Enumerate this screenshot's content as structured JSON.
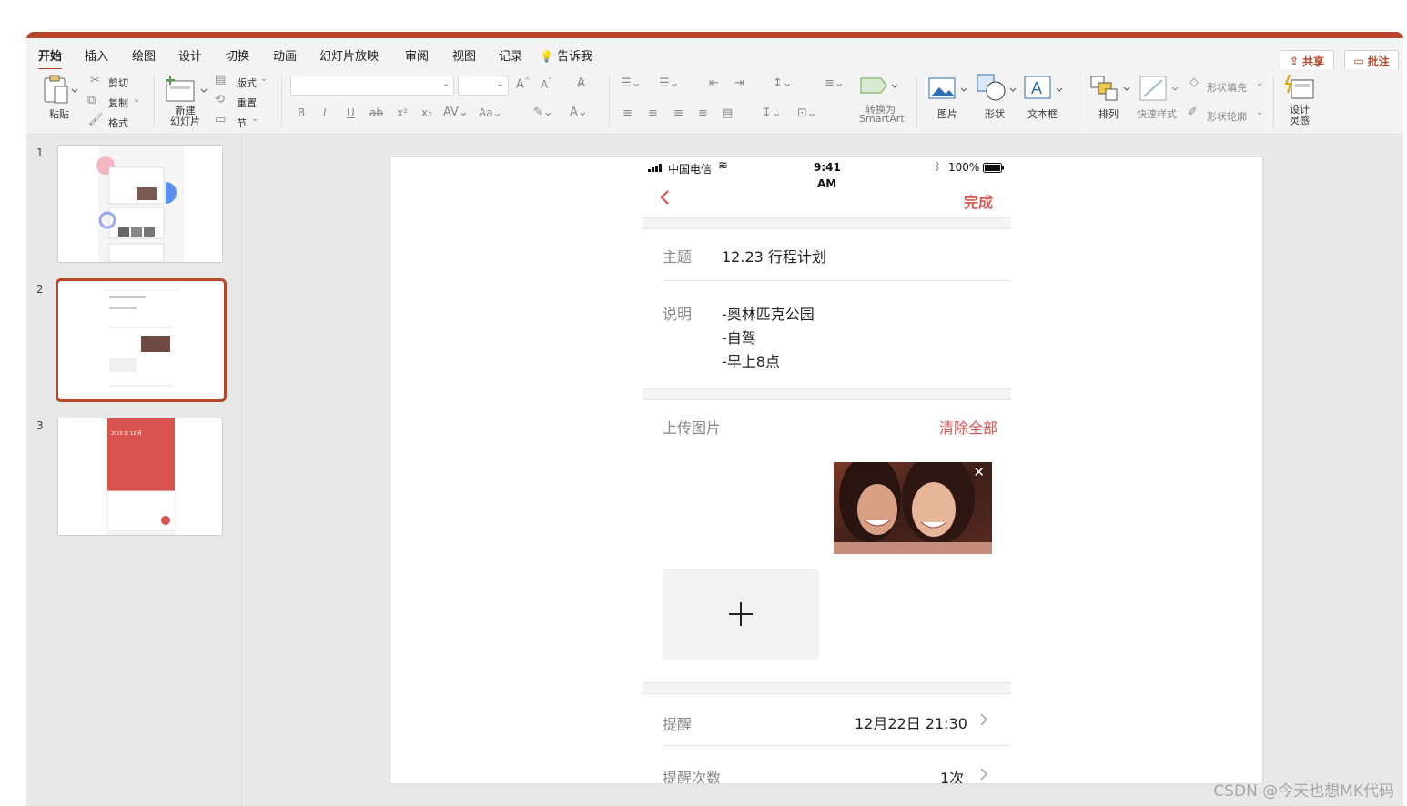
{
  "ribbon_tabs": [
    "开始",
    "插入",
    "绘图",
    "设计",
    "切换",
    "动画",
    "幻灯片放映",
    "审阅",
    "视图",
    "记录",
    "告诉我"
  ],
  "share_label": "共享",
  "comment_label": "批注",
  "ribbon": {
    "paste": "粘贴",
    "cut": "剪切",
    "copy": "复制",
    "format": "格式",
    "new_slide": "新建\n幻灯片",
    "layout": "版式",
    "reset": "重置",
    "section": "节",
    "convert": "转换为",
    "smartart": "SmartArt",
    "picture": "图片",
    "shapes": "形状",
    "textbox": "文本框",
    "arrange": "排列",
    "quick_styles": "快速样式",
    "shape_fill": "形状填充",
    "shape_outline": "形状轮廓",
    "design_ideas": "设计\n灵感"
  },
  "slides": [
    "1",
    "2",
    "3"
  ],
  "thumb3": {
    "header": "2019 年 12 月"
  },
  "phone": {
    "carrier": "中国电信",
    "time": "9:41",
    "ampm": "AM",
    "battery": "100%",
    "done": "完成",
    "subject_label": "主题",
    "subject_value": "12.23 行程计划",
    "desc_label": "说明",
    "desc_lines": [
      "-奥林匹克公园",
      "-自驾",
      "-早上8点"
    ],
    "upload_label": "上传图片",
    "clear_all": "清除全部",
    "reminder_label": "提醒",
    "reminder_value": "12月22日 21:30",
    "count_label": "提醒次数",
    "count_value": "1次"
  },
  "watermark": "CSDN @今天也想MK代码",
  "colors": {
    "accent": "#b7472a",
    "red": "#d9534f"
  }
}
